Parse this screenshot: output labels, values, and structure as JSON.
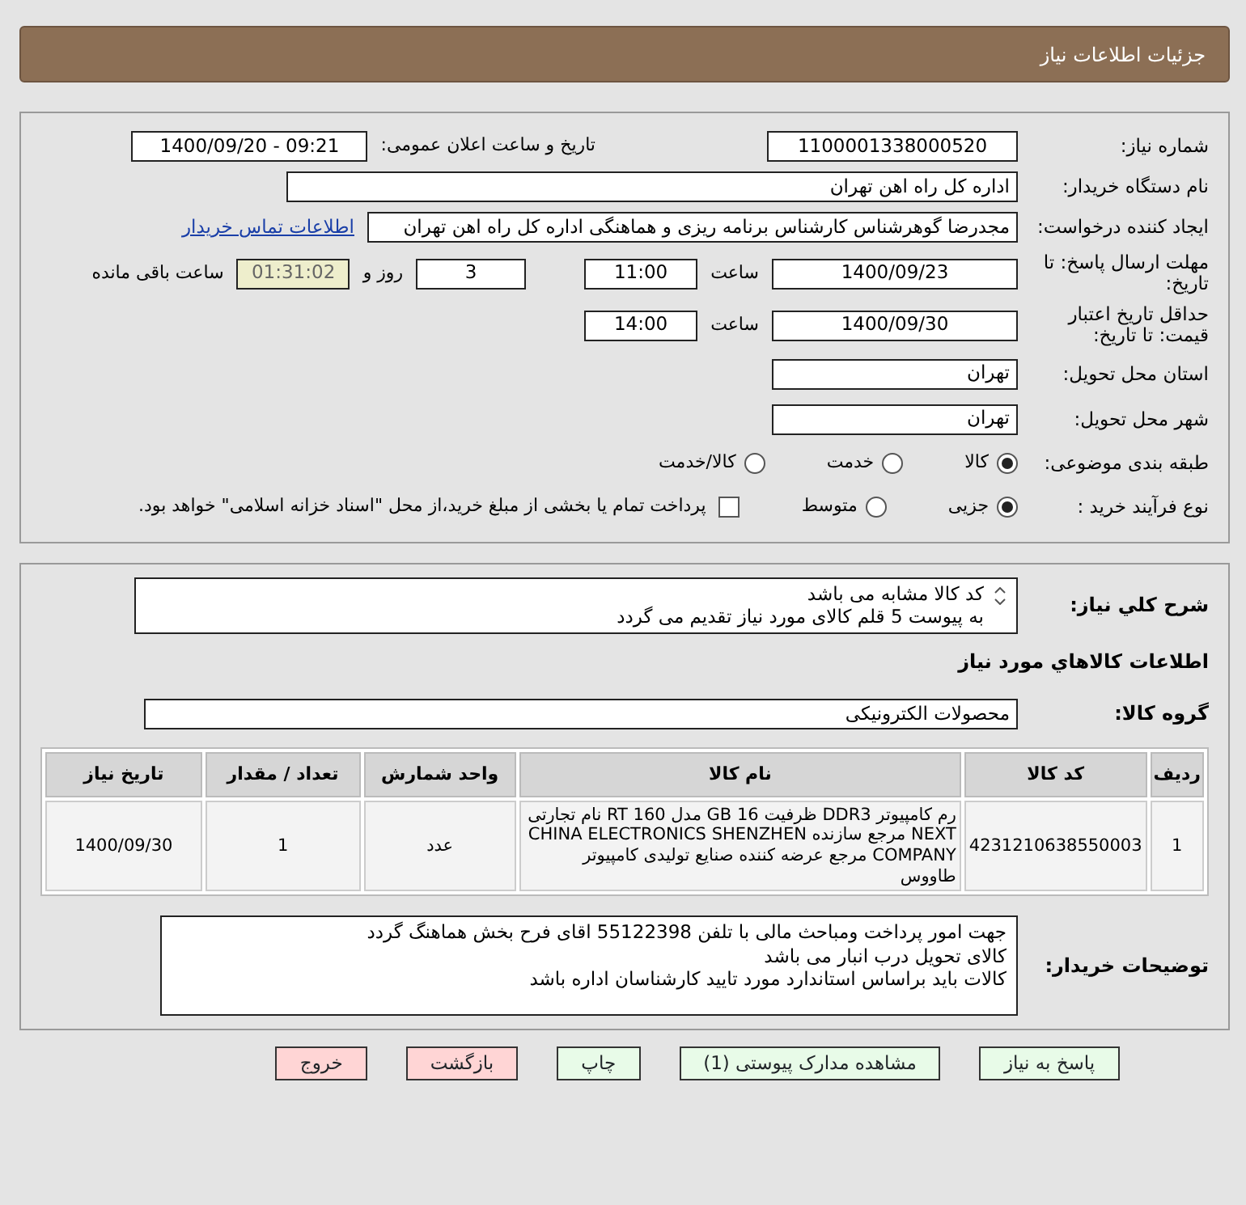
{
  "header": {
    "title": "جزئیات اطلاعات نیاز"
  },
  "need_number": {
    "label": "شماره نیاز:",
    "value": "1100001338000520"
  },
  "announce": {
    "label": "تاریخ و ساعت اعلان عمومی:",
    "value": "1400/09/20 - 09:21"
  },
  "buyer_org": {
    "label": "نام دستگاه خریدار:",
    "value": "اداره کل راه اهن تهران"
  },
  "requester": {
    "label": "ایجاد کننده درخواست:",
    "value": "مجدرضا گوهرشناس کارشناس برنامه ریزی و هماهنگی اداره کل راه اهن تهران",
    "link": "اطلاعات تماس خریدار"
  },
  "deadline": {
    "label": "مهلت ارسال پاسخ: تا تاریخ:",
    "date": "1400/09/23",
    "time_label": "ساعت",
    "time": "11:00",
    "days": "3",
    "days_label": "روز و",
    "remaining": "01:31:02",
    "remaining_label": "ساعت باقی مانده"
  },
  "validity": {
    "label": "حداقل تاریخ اعتبار قیمت: تا تاریخ:",
    "date": "1400/09/30",
    "time_label": "ساعت",
    "time": "14:00"
  },
  "province": {
    "label": "استان محل تحویل:",
    "value": "تهران"
  },
  "city": {
    "label": "شهر محل تحویل:",
    "value": "تهران"
  },
  "category": {
    "label": "طبقه بندی موضوعی:",
    "options": [
      {
        "label": "کالا",
        "selected": true
      },
      {
        "label": "خدمت",
        "selected": false
      },
      {
        "label": "کالا/خدمت",
        "selected": false
      }
    ]
  },
  "process": {
    "label": "نوع فرآیند خرید :",
    "options": [
      {
        "label": "جزیی",
        "selected": true
      },
      {
        "label": "متوسط",
        "selected": false
      }
    ],
    "payment": {
      "label": "پرداخت تمام یا بخشی از مبلغ خرید،از محل \"اسناد خزانه اسلامی\" خواهد بود.",
      "checked": false
    }
  },
  "description": {
    "label": "شرح کلي نياز:",
    "lines": [
      "کد کالا مشابه می باشد",
      "به پیوست 5 قلم کالای مورد نیاز تقدیم می گردد"
    ]
  },
  "goods_title": "اطلاعات كالاهاي مورد نياز",
  "goods_group": {
    "label": "گروه کالا:",
    "value": "محصولات الکترونیکی"
  },
  "table": {
    "columns": [
      "ردیف",
      "کد کالا",
      "نام کالا",
      "واحد شمارش",
      "تعداد / مقدار",
      "تاریخ نیاز"
    ],
    "rows": [
      [
        "1",
        "4231210638550003",
        "رم کامپیوتر DDR3 ظرفیت 16 GB مدل RT 160 نام تجارتی NEXT مرجع سازنده CHINA ELECTRONICS SHENZHEN COMPANY مرجع عرضه کننده صنایع تولیدی کامپیوتر طاووس",
        "عدد",
        "1",
        "1400/09/30"
      ]
    ]
  },
  "buyer_notes": {
    "label": "توضیحات خریدار:",
    "lines": [
      "جهت امور پرداخت ومباحث مالی با تلفن 55122398 اقای فرح بخش هماهنگ گردد",
      "کالای تحویل درب انبار می باشد",
      "کالات باید براساس استاندارد مورد تایید کارشناسان اداره باشد"
    ]
  },
  "buttons": [
    {
      "label": "پاسخ به نیاز",
      "kind": "action"
    },
    {
      "label": "مشاهده مدارک پیوستی (1)",
      "kind": "action"
    },
    {
      "label": "چاپ",
      "kind": "action"
    },
    {
      "label": "بازگشت",
      "kind": "exit"
    },
    {
      "label": "خروج",
      "kind": "exit"
    }
  ]
}
